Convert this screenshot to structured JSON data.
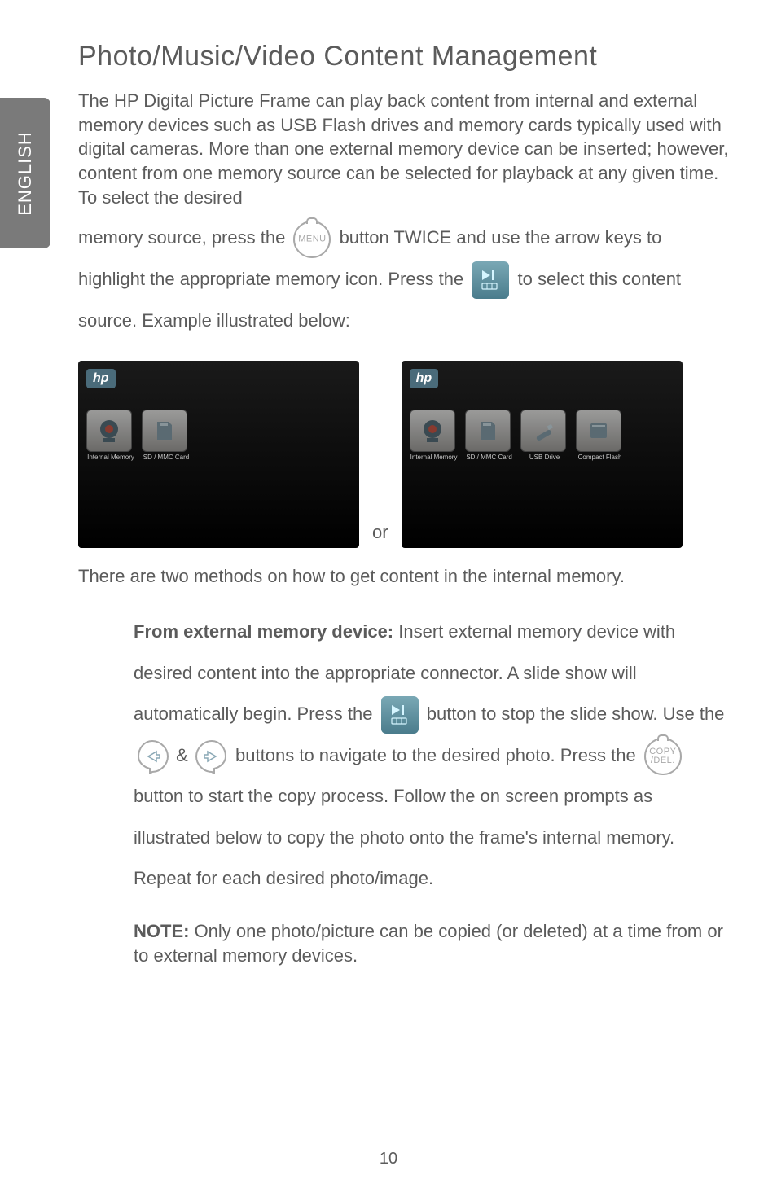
{
  "side_tab": "ENGLISH",
  "title": "Photo/Music/Video Content Management",
  "intro": "The HP Digital Picture Frame can play back content from internal and external memory devices such as USB Flash drives and memory cards typically used with digital cameras.  More than one external memory device can be inserted; however, content from one memory source can be selected for playback at any given time.  To select the desired",
  "flow": {
    "a": "memory source, press the ",
    "menu_label": "MENU",
    "b": " button TWICE and use the arrow keys to highlight the appropriate memory icon.  Press the ",
    "c": " to select this content source. Example illustrated below:"
  },
  "figures": {
    "left": {
      "logo": "hp",
      "items": [
        {
          "caption": "Internal Memory"
        },
        {
          "caption": "SD / MMC Card"
        }
      ]
    },
    "or": "or",
    "right": {
      "logo": "hp",
      "items": [
        {
          "caption": "Internal Memory"
        },
        {
          "caption": "SD / MMC Card"
        },
        {
          "caption": "USB Drive"
        },
        {
          "caption": "Compact Flash"
        }
      ]
    }
  },
  "methods_line": "There are two methods on how to get content in the internal memory.",
  "ext": {
    "heading": "From external memory device:",
    "heading_rest": " Insert external memory device with desired content into the appropriate connector.  A slide show will automatically begin.  Press the ",
    "b": " button to stop the slide show. Use the ",
    "amp": " & ",
    "c": " buttons to navigate to the desired photo. Press the ",
    "copy_label": "COPY\n/DEL.",
    "d": " button to start the copy process.  Follow the on screen prompts as illustrated below to copy the photo onto the frame's internal memory. Repeat for each desired photo/image."
  },
  "note": {
    "label": "NOTE:",
    "text": " Only one photo/picture can be copied (or deleted) at a time from or to external memory devices."
  },
  "page_number": "10"
}
